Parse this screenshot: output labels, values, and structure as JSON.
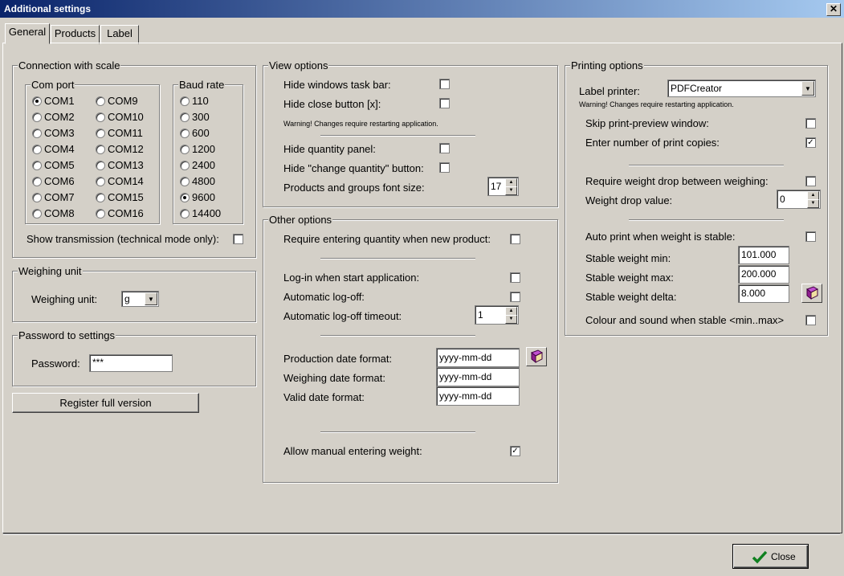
{
  "window": {
    "title": "Additional settings",
    "close_glyph": "✕"
  },
  "tabs": [
    "General",
    "Products",
    "Label"
  ],
  "connection": {
    "group_label": "Connection with scale",
    "com_port_label": "Com port",
    "com_ports": [
      "COM1",
      "COM2",
      "COM3",
      "COM4",
      "COM5",
      "COM6",
      "COM7",
      "COM8",
      "COM9",
      "COM10",
      "COM11",
      "COM12",
      "COM13",
      "COM14",
      "COM15",
      "COM16"
    ],
    "com_selected": "COM1",
    "baud_rate_label": "Baud rate",
    "baud_rates": [
      "110",
      "300",
      "600",
      "1200",
      "2400",
      "4800",
      "9600",
      "14400"
    ],
    "baud_selected": "9600",
    "show_transmission_label": "Show transmission (technical mode only):",
    "show_transmission_checked": false
  },
  "weighing_unit": {
    "group_label": "Weighing unit",
    "label": "Weighing unit:",
    "value": "g"
  },
  "password": {
    "group_label": "Password to settings",
    "label": "Password:",
    "value": "***"
  },
  "register_button": "Register full version",
  "view_options": {
    "group_label": "View options",
    "hide_taskbar": {
      "label": "Hide windows task bar:",
      "checked": false
    },
    "hide_close": {
      "label": "Hide close button [x]:",
      "checked": false
    },
    "warning": "Warning! Changes require restarting application.",
    "hide_qty_panel": {
      "label": "Hide quantity panel:",
      "checked": false
    },
    "hide_change_qty": {
      "label": "Hide \"change quantity\" button:",
      "checked": false
    },
    "font_size": {
      "label": "Products and groups font size:",
      "value": "17"
    }
  },
  "other_options": {
    "group_label": "Other options",
    "require_qty": {
      "label": "Require entering quantity when new product:",
      "checked": false
    },
    "login_start": {
      "label": "Log-in when start application:",
      "checked": false
    },
    "auto_logoff": {
      "label": "Automatic log-off:",
      "checked": false
    },
    "logoff_timeout": {
      "label": "Automatic log-off timeout:",
      "value": "1"
    },
    "production_date": {
      "label": "Production date format:",
      "value": "yyyy-mm-dd"
    },
    "weighing_date": {
      "label": "Weighing date format:",
      "value": "yyyy-mm-dd"
    },
    "valid_date": {
      "label": "Valid date format:",
      "value": "yyyy-mm-dd"
    },
    "manual_weight": {
      "label": "Allow manual entering weight:",
      "checked": true
    }
  },
  "printing_options": {
    "group_label": "Printing options",
    "label_printer": {
      "label": "Label printer:",
      "value": "PDFCreator"
    },
    "warning": "Warning! Changes require restarting application.",
    "skip_preview": {
      "label": "Skip print-preview window:",
      "checked": false
    },
    "print_copies": {
      "label": "Enter number of print copies:",
      "checked": true
    },
    "require_drop": {
      "label": "Require weight drop between weighing:",
      "checked": false
    },
    "drop_value": {
      "label": "Weight drop value:",
      "value": "0"
    },
    "auto_print": {
      "label": "Auto print when weight is stable:",
      "checked": false
    },
    "stable_min": {
      "label": "Stable weight min:",
      "value": "101.000"
    },
    "stable_max": {
      "label": "Stable weight max:",
      "value": "200.000"
    },
    "stable_delta": {
      "label": "Stable weight delta:",
      "value": "8.000"
    },
    "colour_sound": {
      "label": "Colour and sound when stable <min..max>",
      "checked": false
    }
  },
  "close_button": "Close",
  "check_glyph": "✓",
  "icons": {
    "checkmark": "green-checkmark-icon",
    "book": "book-icon"
  },
  "colors": {
    "titlebar_start": "#0a246a",
    "titlebar_end": "#a6caf0",
    "face": "#d4d0c8"
  }
}
